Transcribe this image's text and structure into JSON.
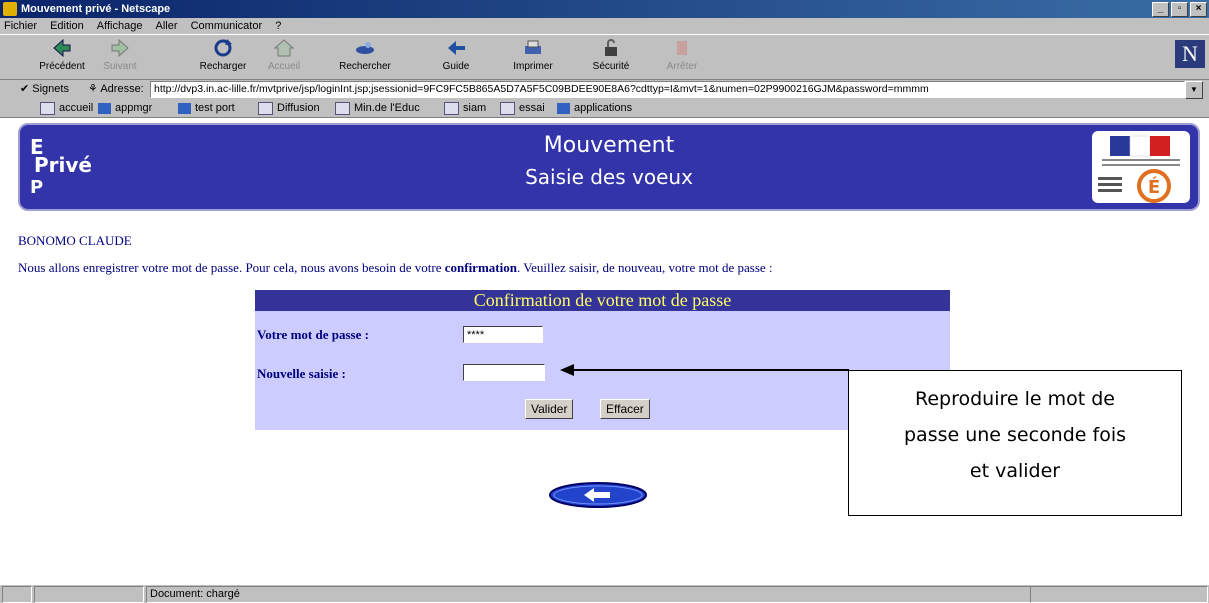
{
  "window": {
    "title": "Mouvement privé - Netscape"
  },
  "menu": [
    "Fichier",
    "Edition",
    "Affichage",
    "Aller",
    "Communicator",
    "?"
  ],
  "toolbar": {
    "back": "Précédent",
    "forward": "Suivant",
    "reload": "Recharger",
    "home": "Accueil",
    "search": "Rechercher",
    "guide": "Guide",
    "print": "Imprimer",
    "security": "Sécurité",
    "stop": "Arrêter"
  },
  "location": {
    "bookmarks_label": "Signets",
    "address_label": "Adresse:",
    "url": "http://dvp3.in.ac-lille.fr/mvtprive/jsp/loginInt.jsp;jsessionid=9FC9FC5B865A5D7A5F5C09BDEE90E8A6?cdttyp=I&mvt=1&numen=02P9900216GJM&password=mmmm"
  },
  "personal_bar": [
    "accueil",
    "appmgr",
    "test port",
    "Diffusion",
    "Min.de l'Educ",
    "siam",
    "essai",
    "applications"
  ],
  "banner": {
    "left_line1": "E",
    "left_line2": "Privé",
    "left_line3": "P",
    "title1": "Mouvement",
    "title2": "Saisie des voeux"
  },
  "page": {
    "user_name": "BONOMO CLAUDE",
    "message_before": "Nous allons enregistrer votre mot de passe. Pour cela, nous avons besoin de votre ",
    "message_bold": "confirmation",
    "message_after": ". Veuillez saisir, de nouveau, votre mot de passe :"
  },
  "form": {
    "heading": "Confirmation de votre mot de passe",
    "password_label": "Votre mot de passe :",
    "password_value": "****",
    "new_entry_label": "Nouvelle saisie :",
    "new_entry_value": "",
    "submit_label": "Valider",
    "reset_label": "Effacer"
  },
  "callout": {
    "line1": "Reproduire le mot de",
    "line2": "passe une seconde fois",
    "line3": "et valider"
  },
  "status": {
    "text": "Document: chargé"
  },
  "colors": {
    "banner": "#3333aa",
    "form_bg": "#ccccff",
    "form_header": "#333399",
    "heading_text": "#ffff66",
    "text_navy": "#000080"
  }
}
